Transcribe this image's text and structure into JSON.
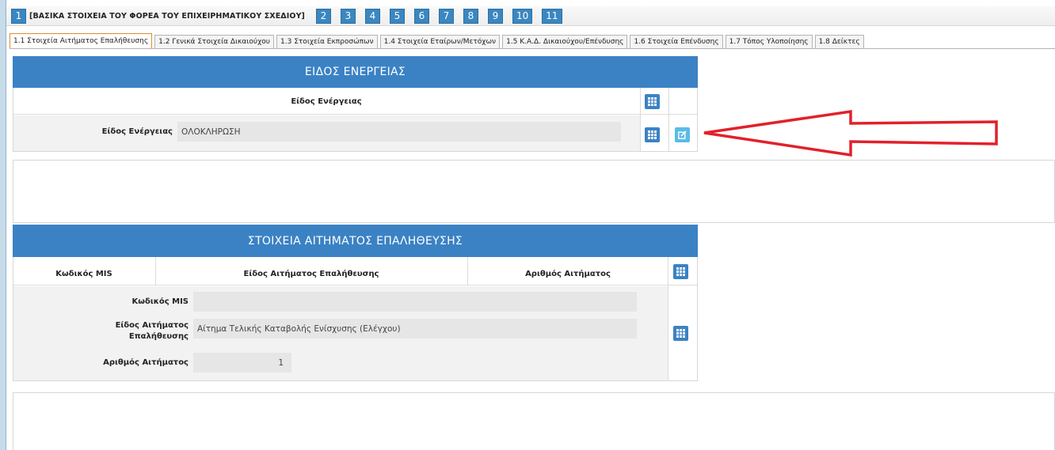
{
  "steps": {
    "first_number": "1",
    "first_title": "[ΒΑΣΙΚΑ ΣΤΟΙΧΕΙΑ ΤΟΥ ΦΟΡΕΑ ΤΟΥ ΕΠΙΧΕΙΡΗΜΑΤΙΚΟΥ ΣΧΕΔΙΟΥ]",
    "others": [
      "2",
      "3",
      "4",
      "5",
      "6",
      "7",
      "8",
      "9",
      "10",
      "11"
    ]
  },
  "tabs": [
    "1.1 Στοιχεία Αιτήματος Επαλήθευσης",
    "1.2 Γενικά Στοιχεία Δικαιούχου",
    "1.3 Στοιχεία Εκπροσώπων",
    "1.4 Στοιχεία Εταίρων/Μετόχων",
    "1.5 Κ.Α.Δ. Δικαιούχου/Επένδυσης",
    "1.6 Στοιχεία Επένδυσης",
    "1.7 Τόπος Υλοποίησης",
    "1.8 Δείκτες"
  ],
  "action_type": {
    "title": "ΕΙΔΟΣ ΕΝΕΡΓΕΙΑΣ",
    "column_header": "Είδος Ενέργειας",
    "field_label": "Είδος Ενέργειας",
    "field_value": "ΟΛΟΚΛΗΡΩΣΗ"
  },
  "verification_request": {
    "title": "ΣΤΟΙΧΕΙΑ ΑΙΤΗΜΑΤΟΣ ΕΠΑΛΗΘΕΥΣΗΣ",
    "columns": [
      "Κωδικός MIS",
      "Είδος Αιτήματος Επαλήθευσης",
      "Αριθμός Αιτήματος"
    ],
    "mis_label": "Κωδικός MIS",
    "mis_value": "",
    "type_label_1": "Είδος Αιτήματος",
    "type_label_2": "Επαλήθευσης",
    "type_value": "Αίτημα Τελικής Καταβολής Ενίσχυσης (Ελέγχου)",
    "number_label": "Αριθμός Αιτήματος",
    "number_value": "1"
  },
  "colors": {
    "header_blue": "#3b82c4",
    "edit_button": "#5bbbe6",
    "arrow_red": "#e3202a"
  }
}
